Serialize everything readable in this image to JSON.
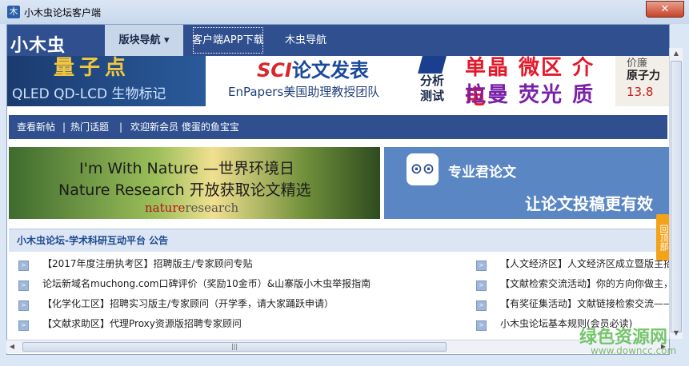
{
  "window": {
    "title": "小木虫论坛客户端",
    "icon": "app-icon",
    "close_glyph": "✕"
  },
  "nav": {
    "logo": "小木虫",
    "active_tab": "版块导航 ▾",
    "links": [
      "客户端APP下载",
      "木虫导航"
    ]
  },
  "banners": {
    "b1_big": "量子点",
    "b1_sub": "QLED  QD-LCD  生物标记",
    "b2_sci": "SCI",
    "b2_title": "论文发表",
    "b2_sub": "EnPapers美国助理教授团队",
    "b3_side": "分析测试",
    "b3_row1": "单晶 微区 介电",
    "b3_row2": "拉曼 荧光 质谱",
    "b4_l1": "价廉",
    "b4_l2": "原子力",
    "b4_l3": "13.8"
  },
  "linkbar": {
    "new_posts": "查看新帖",
    "sep": "|",
    "hot": "热门话题",
    "welcome": "欢迎新会员 傻蛋的鱼宝宝"
  },
  "ads": {
    "left_line1": "I'm With Nature —世界环境日",
    "left_line2": "Nature Research 开放获取论文精选",
    "left_brand_a": "nature",
    "left_brand_b": "research",
    "right_title": "专业君论文",
    "right_slogan": "让论文投稿更有效",
    "right_icon": "owl-glasses-icon"
  },
  "notice": {
    "header": "小木虫论坛-学术科研互动平台 公告",
    "left": [
      "【2017年度注册执考区】招聘版主/专家顾问专贴",
      "论坛新域名muchong.com口碑评价（奖励10金币）&山寨版小木虫举报指南",
      "【化学化工区】招聘实习版主/专家顾问（开学季，请大家踊跃申请）",
      "【文献求助区】代理Proxy资源版招聘专家顾问"
    ],
    "right": [
      "【人文经济区】人文经济区成立暨版主招",
      "【文献检索交流活动】你的方向你做主，",
      "【有奖征集活动】文献链接检索交流——",
      "小木虫论坛基本规则(会员必读)"
    ]
  },
  "backtop": "回顶部",
  "watermark": {
    "cn": "绿色资源网",
    "url": "www.downcc.com"
  }
}
